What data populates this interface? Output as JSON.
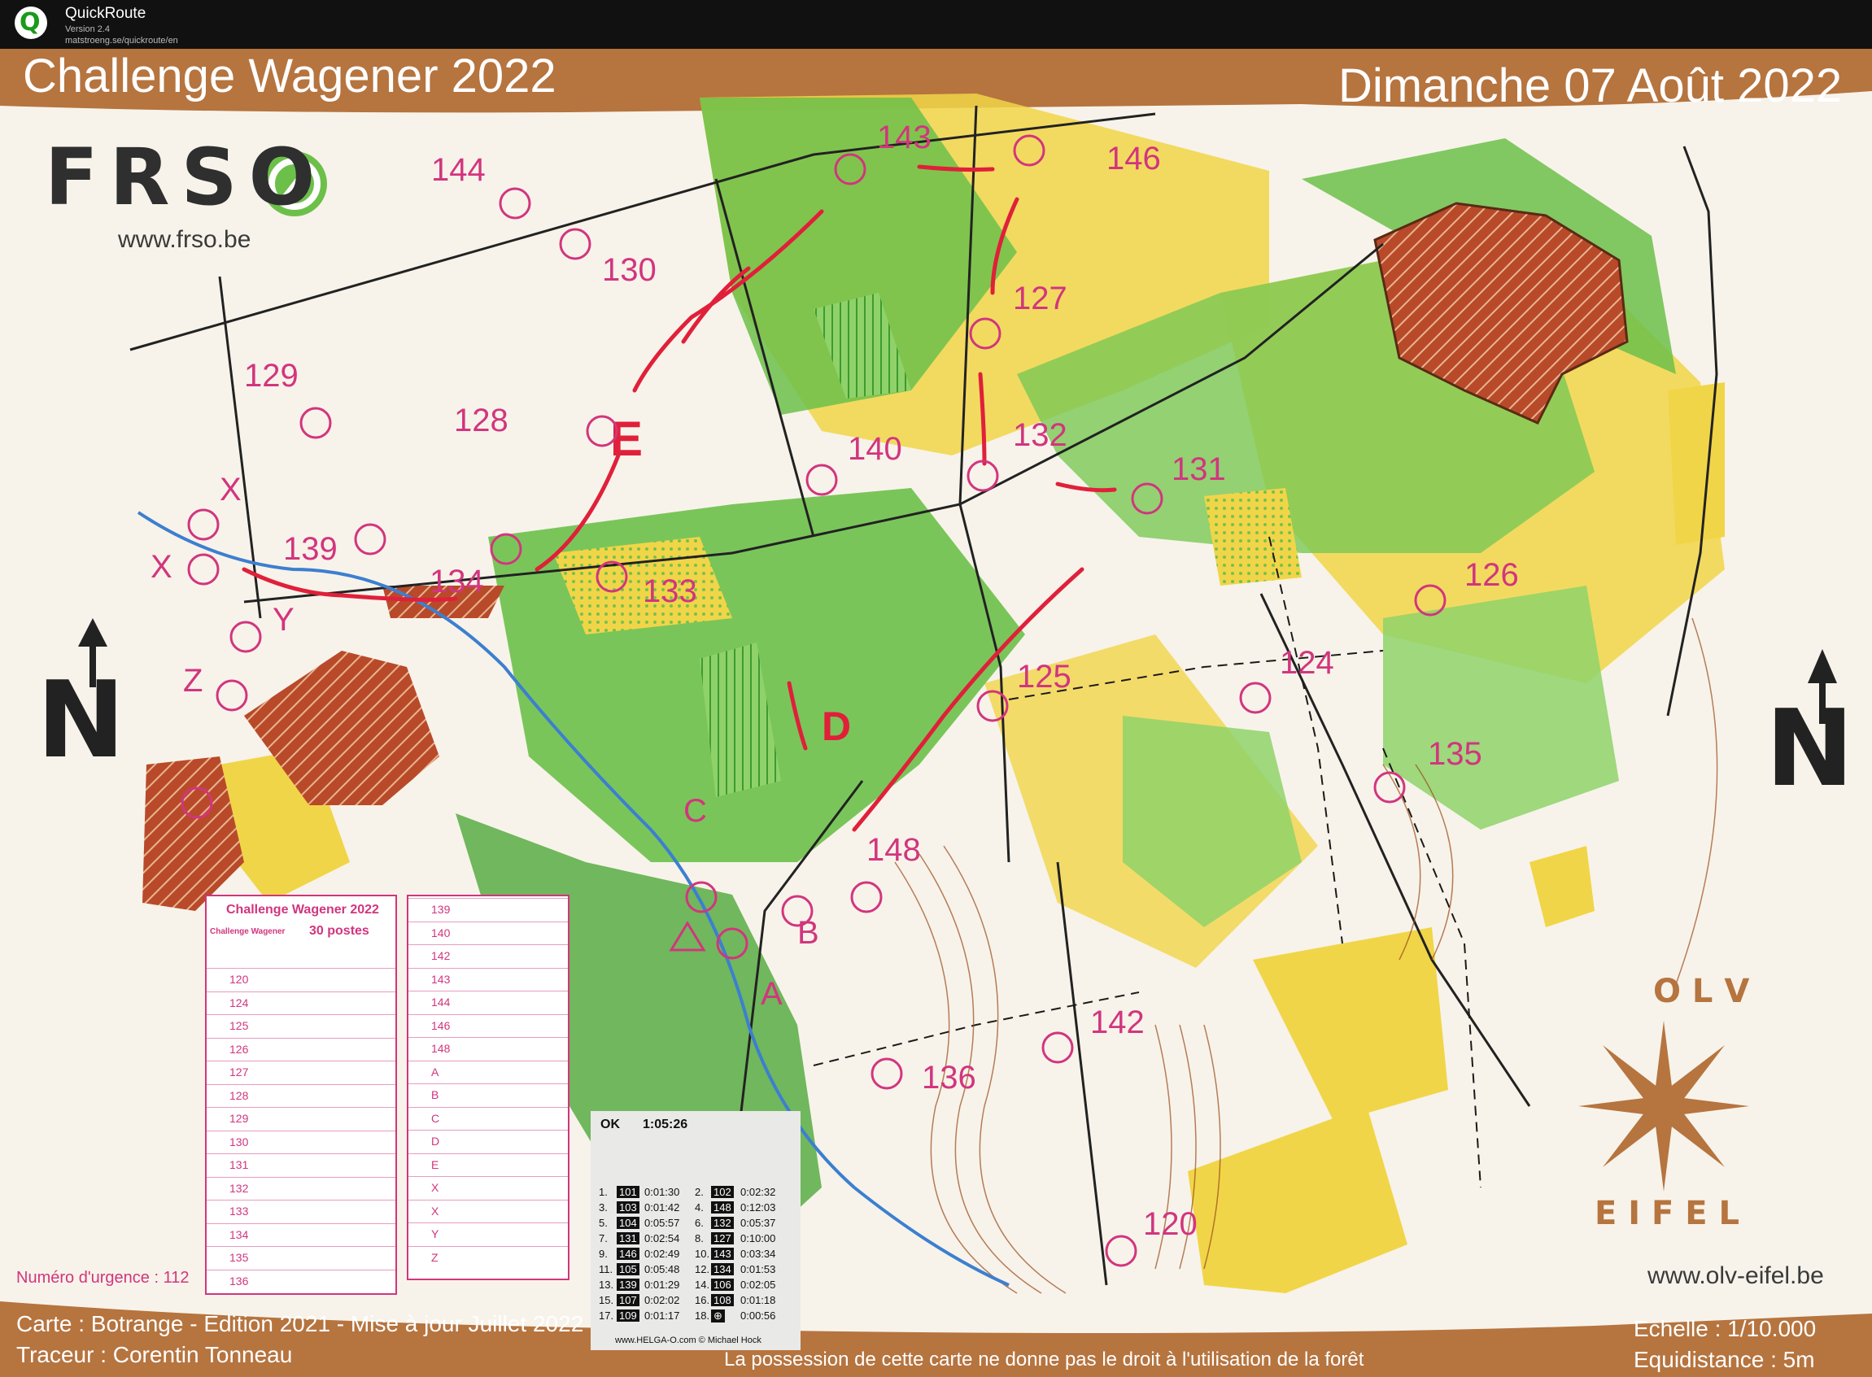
{
  "app": {
    "name": "QuickRoute",
    "version": "Version 2.4",
    "url": "matstroeng.se/quickroute/en"
  },
  "map": {
    "title": "Challenge Wagener 2022",
    "date": "Dimanche 07 Août 2022",
    "frso_logo": "FRSO",
    "frso_url": "www.frso.be",
    "olv_top": "OLV",
    "olv_bottom": "EIFEL",
    "olv_url": "www.olv-eifel.be",
    "north": "N",
    "emergency": "Numéro d'urgence : 112",
    "carte": "Carte : Botrange - Edition 2021 - Mise à jour Juillet 2022",
    "traceur": "Traceur : Corentin Tonneau",
    "notice": "La possession de cette carte ne donne pas le droit à l'utilisation de la forêt",
    "echelle": "Echelle : 1/10.000",
    "equidistance": "Equidistance : 5m"
  },
  "controls": [
    {
      "label": "144"
    },
    {
      "label": "143"
    },
    {
      "label": "146"
    },
    {
      "label": "130"
    },
    {
      "label": "127"
    },
    {
      "label": "129"
    },
    {
      "label": "128"
    },
    {
      "label": "140"
    },
    {
      "label": "132"
    },
    {
      "label": "131"
    },
    {
      "label": "139"
    },
    {
      "label": "134"
    },
    {
      "label": "133"
    },
    {
      "label": "126"
    },
    {
      "label": "124"
    },
    {
      "label": "125"
    },
    {
      "label": "135"
    },
    {
      "label": "148"
    },
    {
      "label": "142"
    },
    {
      "label": "136"
    },
    {
      "label": "120"
    },
    {
      "label": "X"
    },
    {
      "label": "X"
    },
    {
      "label": "Y"
    },
    {
      "label": "Z"
    },
    {
      "label": "C"
    },
    {
      "label": "B"
    },
    {
      "label": "A"
    },
    {
      "label": "E"
    },
    {
      "label": "D"
    }
  ],
  "description_sheet": {
    "title": "Challenge Wagener 2022",
    "subtitle": "Challenge Wagener",
    "postes": "30 postes",
    "left_codes": [
      "120",
      "124",
      "125",
      "126",
      "127",
      "128",
      "129",
      "130",
      "131",
      "132",
      "133",
      "134",
      "135",
      "136"
    ],
    "right_codes": [
      "139",
      "140",
      "142",
      "143",
      "144",
      "146",
      "148",
      "A",
      "B",
      "C",
      "D",
      "E",
      "X",
      "X",
      "Y",
      "Z"
    ]
  },
  "receipt": {
    "status": "OK",
    "total_time": "1:05:26",
    "splits": [
      {
        "n": "1.",
        "code": "101",
        "time": "0:01:30",
        "n2": "2.",
        "code2": "102",
        "time2": "0:02:32"
      },
      {
        "n": "3.",
        "code": "103",
        "time": "0:01:42",
        "n2": "4.",
        "code2": "148",
        "time2": "0:12:03"
      },
      {
        "n": "5.",
        "code": "104",
        "time": "0:05:57",
        "n2": "6.",
        "code2": "132",
        "time2": "0:05:37"
      },
      {
        "n": "7.",
        "code": "131",
        "time": "0:02:54",
        "n2": "8.",
        "code2": "127",
        "time2": "0:10:00"
      },
      {
        "n": "9.",
        "code": "146",
        "time": "0:02:49",
        "n2": "10.",
        "code2": "143",
        "time2": "0:03:34"
      },
      {
        "n": "11.",
        "code": "105",
        "time": "0:05:48",
        "n2": "12.",
        "code2": "134",
        "time2": "0:01:53"
      },
      {
        "n": "13.",
        "code": "139",
        "time": "0:01:29",
        "n2": "14.",
        "code2": "106",
        "time2": "0:02:05"
      },
      {
        "n": "15.",
        "code": "107",
        "time": "0:02:02",
        "n2": "16.",
        "code2": "108",
        "time2": "0:01:18"
      },
      {
        "n": "17.",
        "code": "109",
        "time": "0:01:17",
        "n2": "18.",
        "code2": "⊕",
        "time2": "0:00:56"
      }
    ],
    "footer": "www.HELGA-O.com © Michael Hock"
  },
  "colors": {
    "header_brown": "#b6743f",
    "course_magenta": "#d2357e",
    "route_red": "#e0203a",
    "forest_green": "#6cc04a",
    "open_yellow": "#f1d548"
  }
}
